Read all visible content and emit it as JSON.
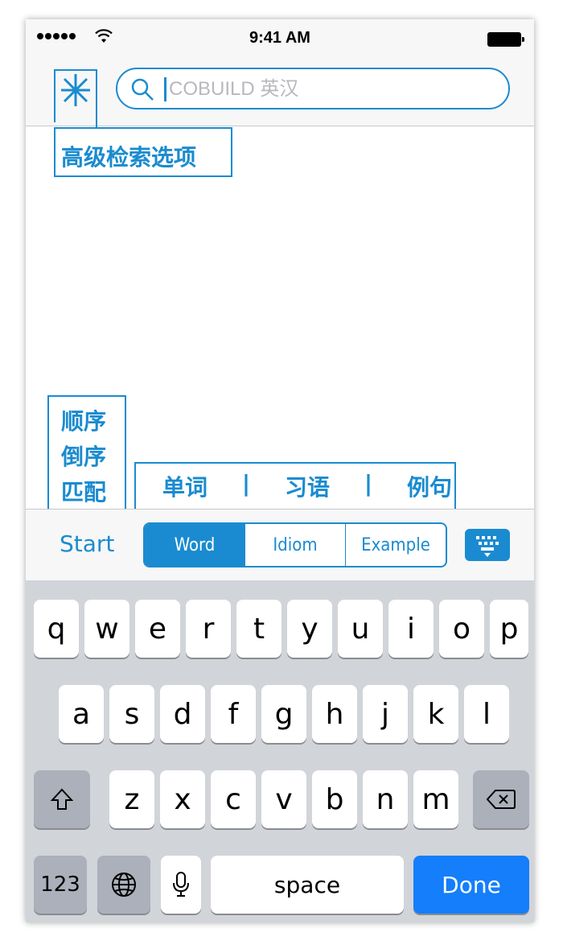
{
  "status": {
    "time": "9:41 AM"
  },
  "search": {
    "placeholder": "COBUILD 英汉"
  },
  "annotations": {
    "advanced": "高级检索选项",
    "order": [
      "顺序",
      "倒序",
      "匹配"
    ],
    "categories": [
      "单词",
      "|",
      "习语",
      "|",
      "例句"
    ]
  },
  "toolbar": {
    "start": "Start",
    "segments": [
      "Word",
      "Idiom",
      "Example"
    ],
    "selected": "Word"
  },
  "keyboard": {
    "row1": [
      "q",
      "w",
      "e",
      "r",
      "t",
      "y",
      "u",
      "i",
      "o",
      "p"
    ],
    "row2": [
      "a",
      "s",
      "d",
      "f",
      "g",
      "h",
      "j",
      "k",
      "l"
    ],
    "row3": [
      "z",
      "x",
      "c",
      "v",
      "b",
      "n",
      "m"
    ],
    "num_label": "123",
    "space_label": "space",
    "done_label": "Done"
  },
  "colors": {
    "accent": "#1a8bd0",
    "done": "#147efb",
    "keyboard_bg": "#d1d4d9"
  }
}
